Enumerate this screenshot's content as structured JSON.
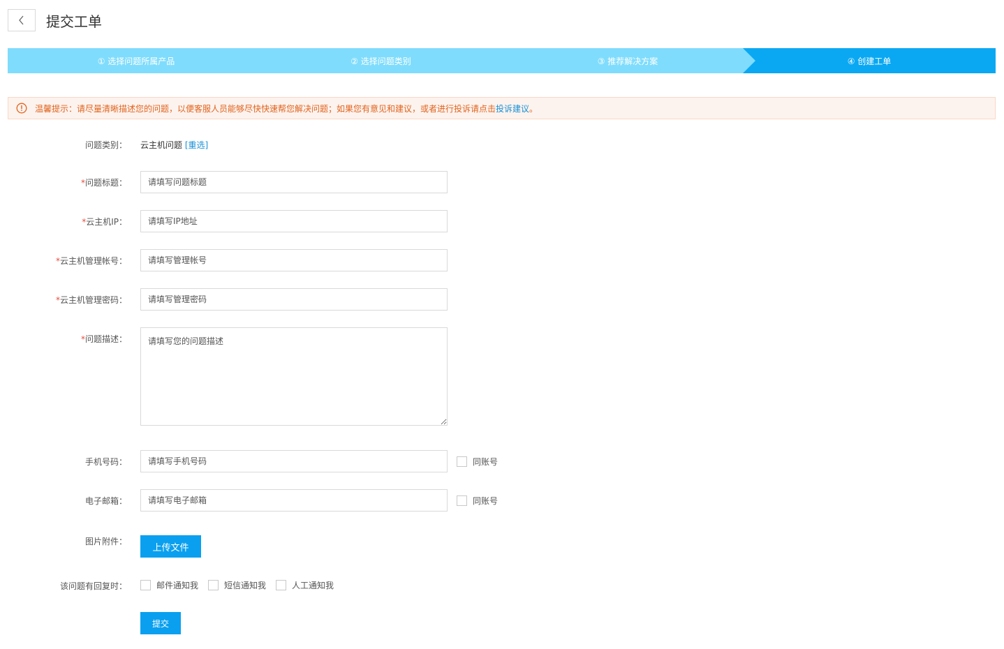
{
  "header": {
    "title": "提交工单",
    "back_icon": "chevron-left-icon"
  },
  "steps": [
    {
      "label": "① 选择问题所属产品",
      "state": "done"
    },
    {
      "label": "② 选择问题类别",
      "state": "done"
    },
    {
      "label": "③ 推荐解决方案",
      "state": "done"
    },
    {
      "label": "④ 创建工单",
      "state": "active"
    }
  ],
  "colors": {
    "step_done": "#7fdcfc",
    "step_active": "#0aa8f2",
    "primary": "#0aa0ef",
    "notice_text": "#e0641e",
    "link": "#1890d5",
    "required": "#e84c3d"
  },
  "notice": {
    "icon": "warning-circle-icon",
    "text": "温馨提示：请尽量清晰描述您的问题，以便客服人员能够尽快快速帮您解决问题；如果您有意见和建议，或者进行投诉请点击",
    "link": "投诉建议",
    "suffix": "。"
  },
  "form": {
    "category": {
      "label": "问题类别：",
      "value": "云主机问题",
      "reselect": "[重选]"
    },
    "required_mark": "*",
    "title": {
      "label": "问题标题：",
      "placeholder": "请填写问题标题"
    },
    "ip": {
      "label": "云主机IP：",
      "placeholder": "请填写IP地址"
    },
    "account": {
      "label": "云主机管理帐号：",
      "placeholder": "请填写管理帐号"
    },
    "password": {
      "label": "云主机管理密码：",
      "placeholder": "请填写管理密码"
    },
    "description": {
      "label": "问题描述：",
      "placeholder": "请填写您的问题描述"
    },
    "phone": {
      "label": "手机号码：",
      "placeholder": "请填写手机号码",
      "same_label": "同账号"
    },
    "email": {
      "label": "电子邮箱：",
      "placeholder": "请填写电子邮箱",
      "same_label": "同账号"
    },
    "attachment": {
      "label": "图片附件：",
      "button": "上传文件"
    },
    "notify": {
      "label": "该问题有回复时：",
      "options": [
        "邮件通知我",
        "短信通知我",
        "人工通知我"
      ]
    },
    "submit": "提交"
  }
}
